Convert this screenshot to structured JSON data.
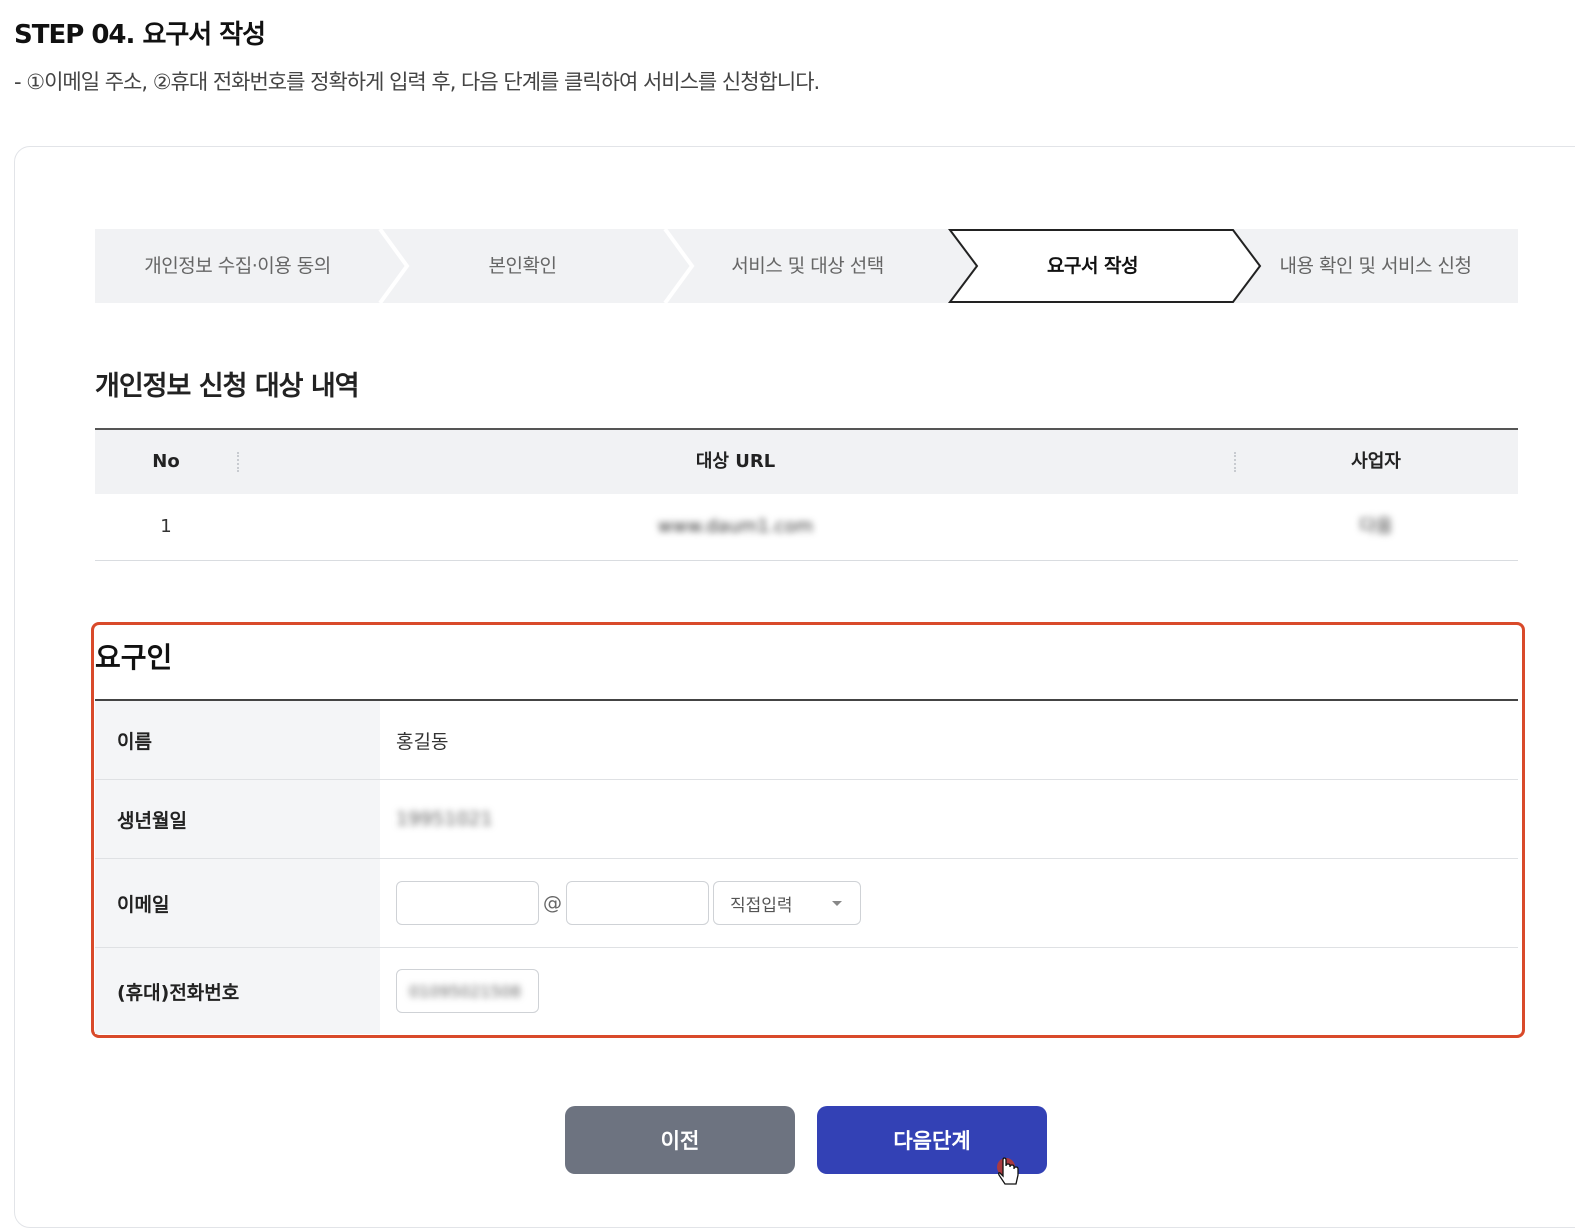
{
  "header": {
    "step_title": "STEP 04. 요구서 작성",
    "description": "- ①이메일 주소, ②휴대 전화번호를 정확하게 입력 후, 다음 단계를 클릭하여 서비스를 신청합니다."
  },
  "stepper": {
    "steps": [
      "개인정보 수집·이용 동의",
      "본인확인",
      "서비스 및 대상 선택",
      "요구서 작성",
      "내용 확인 및 서비스 신청"
    ],
    "active_index": 3
  },
  "targets": {
    "title": "개인정보 신청 대상 내역",
    "columns": [
      "No",
      "대상 URL",
      "사업자"
    ],
    "rows": [
      {
        "no": "1",
        "url": "www.daum1.com",
        "company": "다음"
      }
    ]
  },
  "requester": {
    "title": "요구인",
    "name_label": "이름",
    "name_value": "홍길동",
    "birth_label": "생년월일",
    "birth_value": "19951021",
    "email_label": "이메일",
    "email_at": "@",
    "email_domain_select": "직접입력",
    "phone_label": "(휴대)전화번호",
    "phone_value": "01095021508"
  },
  "buttons": {
    "prev": "이전",
    "next": "다음단계"
  },
  "colors": {
    "highlight_border": "#d94a2a",
    "primary": "#3341b5",
    "secondary": "#6d7380"
  }
}
